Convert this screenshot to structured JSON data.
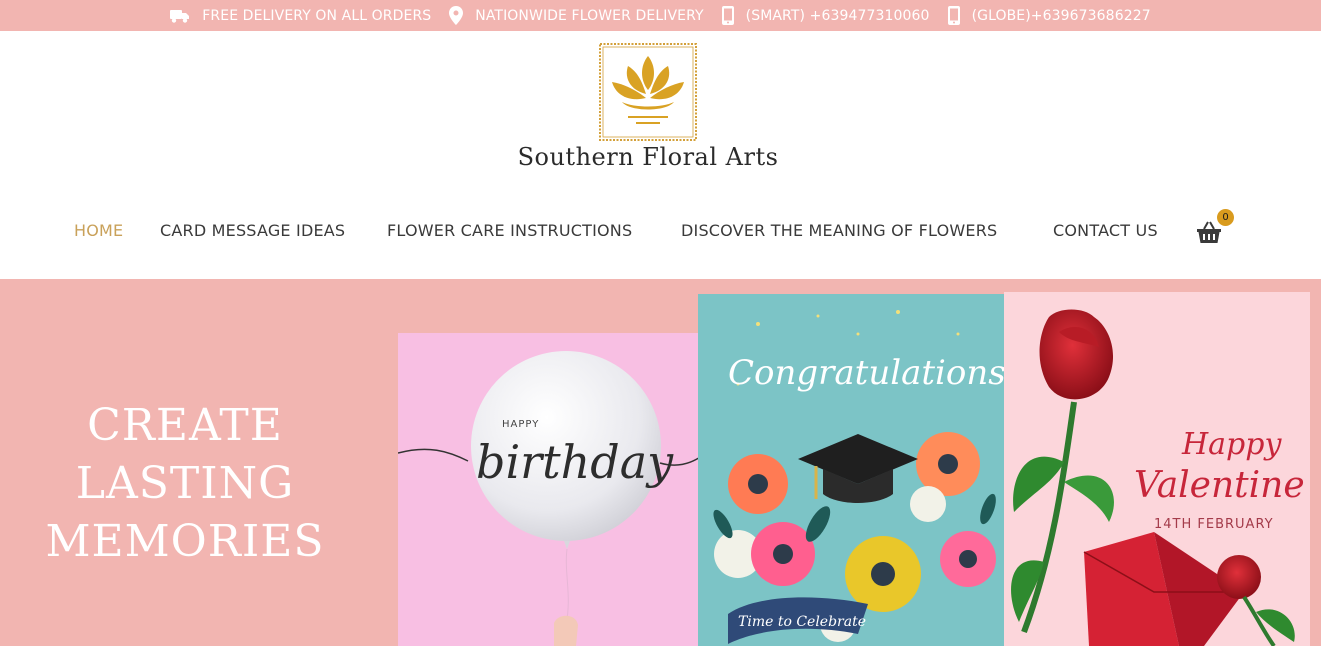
{
  "topbar": {
    "delivery": "FREE DELIVERY ON ALL ORDERS",
    "nationwide": "NATIONWIDE FLOWER DELIVERY",
    "smart": "(SMART) +639477310060",
    "globe": "(GLOBE)+639673686227"
  },
  "brand": {
    "name": "Southern Floral Arts"
  },
  "nav": {
    "items": [
      {
        "label": "HOME",
        "active": true
      },
      {
        "label": "CARD MESSAGE IDEAS",
        "active": false
      },
      {
        "label": "FLOWER CARE INSTRUCTIONS",
        "active": false
      },
      {
        "label": "DISCOVER THE MEANING OF FLOWERS",
        "active": false
      },
      {
        "label": "CONTACT US",
        "active": false
      }
    ],
    "cart_count": "0"
  },
  "hero": {
    "title_lines": [
      "CREATE",
      "LASTING",
      "MEMORIES"
    ],
    "cards": {
      "birthday": {
        "small": "HAPPY",
        "big": "birthday"
      },
      "congrats": {
        "title": "Congratulations!",
        "footer": "Time to Celebrate"
      },
      "valentine": {
        "line1": "Happy",
        "line2": "Valentine",
        "date": "14TH FEBRUARY"
      }
    }
  },
  "colors": {
    "pink": "#f2b5b1",
    "gold": "#c9a15a",
    "badge": "#d99b1e"
  },
  "icons": [
    "truck-icon",
    "location-pin-icon",
    "phone-icon",
    "phone-icon",
    "cart-basket-icon",
    "lotus-logo-icon"
  ]
}
